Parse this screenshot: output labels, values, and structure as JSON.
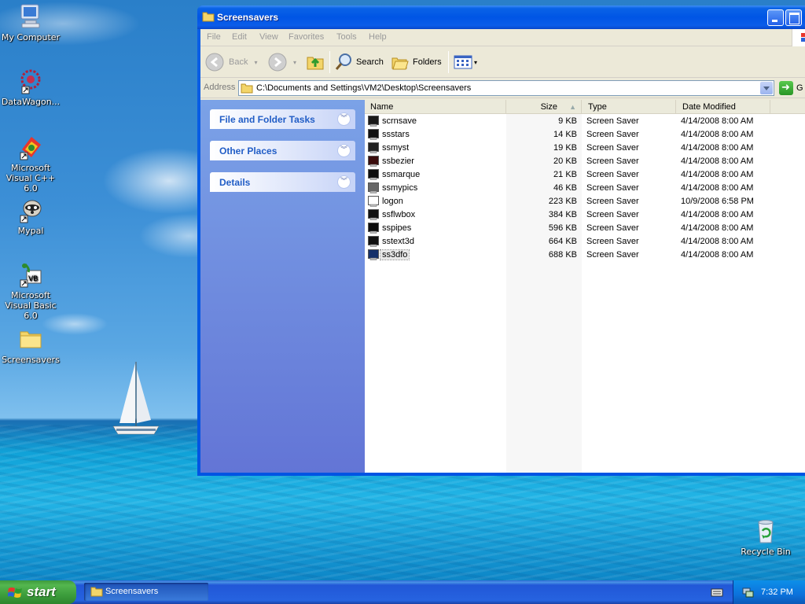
{
  "desktop": {
    "icons": [
      {
        "label": "My Computer"
      },
      {
        "label": "DataWagon..."
      },
      {
        "label": "Microsoft Visual C++ 6.0"
      },
      {
        "label": "Mypal"
      },
      {
        "label": "Microsoft Visual Basic 6.0"
      },
      {
        "label": "Screensavers"
      },
      {
        "label": "Recycle Bin"
      }
    ]
  },
  "window": {
    "title": "Screensavers",
    "menu": [
      "File",
      "Edit",
      "View",
      "Favorites",
      "Tools",
      "Help"
    ],
    "toolbar": {
      "back_label": "Back",
      "search_label": "Search",
      "folders_label": "Folders"
    },
    "address": {
      "label": "Address",
      "value": "C:\\Documents and Settings\\VM2\\Desktop\\Screensavers",
      "go_label": "G"
    },
    "taskpane": {
      "sections": [
        {
          "label": "File and Folder Tasks"
        },
        {
          "label": "Other Places"
        },
        {
          "label": "Details"
        }
      ]
    },
    "columns": {
      "name": "Name",
      "size": "Size",
      "type": "Type",
      "date": "Date Modified"
    },
    "files": [
      {
        "name": "scrnsave",
        "size": "9 KB",
        "type": "Screen Saver",
        "date": "4/14/2008 8:00 AM",
        "icon": "screensaver-icon"
      },
      {
        "name": "ssstars",
        "size": "14 KB",
        "type": "Screen Saver",
        "date": "4/14/2008 8:00 AM",
        "icon": "screensaver-icon"
      },
      {
        "name": "ssmyst",
        "size": "19 KB",
        "type": "Screen Saver",
        "date": "4/14/2008 8:00 AM",
        "icon": "screensaver-icon"
      },
      {
        "name": "ssbezier",
        "size": "20 KB",
        "type": "Screen Saver",
        "date": "4/14/2008 8:00 AM",
        "icon": "screensaver-icon"
      },
      {
        "name": "ssmarque",
        "size": "21 KB",
        "type": "Screen Saver",
        "date": "4/14/2008 8:00 AM",
        "icon": "screensaver-icon"
      },
      {
        "name": "ssmypics",
        "size": "46 KB",
        "type": "Screen Saver",
        "date": "4/14/2008 8:00 AM",
        "icon": "screensaver-icon"
      },
      {
        "name": "logon",
        "size": "223 KB",
        "type": "Screen Saver",
        "date": "10/9/2008 6:58 PM",
        "icon": "screensaver-icon"
      },
      {
        "name": "ssflwbox",
        "size": "384 KB",
        "type": "Screen Saver",
        "date": "4/14/2008 8:00 AM",
        "icon": "screensaver-icon"
      },
      {
        "name": "sspipes",
        "size": "596 KB",
        "type": "Screen Saver",
        "date": "4/14/2008 8:00 AM",
        "icon": "screensaver-icon"
      },
      {
        "name": "sstext3d",
        "size": "664 KB",
        "type": "Screen Saver",
        "date": "4/14/2008 8:00 AM",
        "icon": "screensaver-icon"
      },
      {
        "name": "ss3dfo",
        "size": "688 KB",
        "type": "Screen Saver",
        "date": "4/14/2008 8:00 AM",
        "icon": "screensaver-icon"
      }
    ]
  },
  "taskbar": {
    "start_label": "start",
    "task_label": "Screensavers",
    "clock": "7:32 PM"
  },
  "colors": {
    "title_blue": "#0055e5",
    "taskpane_link": "#215dc6",
    "start_green": "#3d9e3d"
  }
}
